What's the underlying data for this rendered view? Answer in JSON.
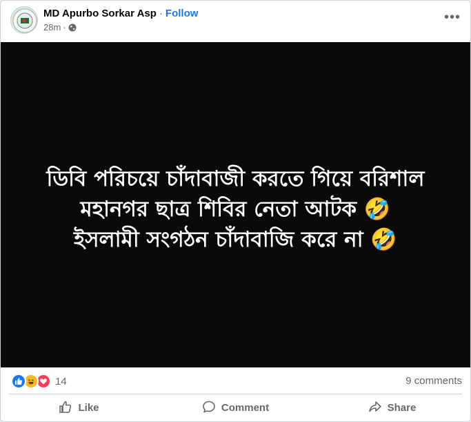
{
  "post": {
    "author": "MD Apurbo Sorkar Asp",
    "separator": "·",
    "follow_label": "Follow",
    "time": "28m",
    "meta_separator": "·",
    "privacy_icon": "globe-icon",
    "more_icon": "more-options-icon",
    "more_glyph": "•••",
    "image_text": "ডিবি পরিচয়ে চাঁদাবাজী করতে গিয়ে বরিশাল\nমহানগর ছাত্র শিবির নেতা আটক 🤣\nইসলামী সংগঠন চাঁদাবাজি করে না 🤣",
    "image_background": "#0a0a0a"
  },
  "stats": {
    "reactions": [
      "like",
      "haha",
      "love"
    ],
    "reaction_count": "14",
    "comments_label": "9 comments"
  },
  "actions": {
    "like_label": "Like",
    "comment_label": "Comment",
    "share_label": "Share"
  },
  "colors": {
    "accent": "#1877f2",
    "secondary_text": "#65676b",
    "love": "#f33e58",
    "haha": "#f7b928"
  }
}
